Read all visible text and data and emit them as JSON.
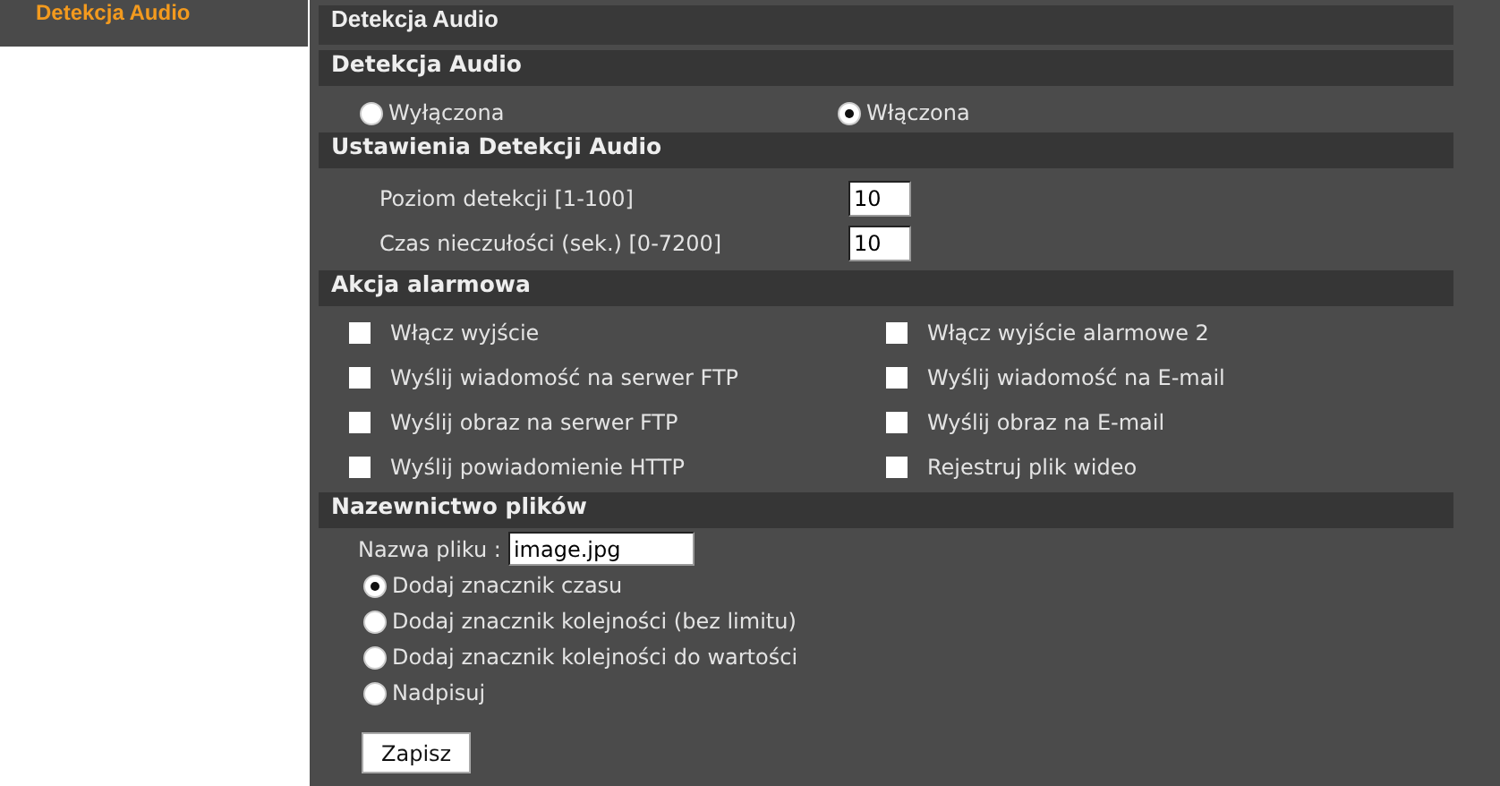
{
  "sidebar": {
    "items": [
      {
        "label": "Detekcja Audio",
        "selected": true
      }
    ]
  },
  "page_title": "Detekcja Audio",
  "sections": [
    {
      "kind": "radios",
      "title": "Detekcja Audio",
      "options": [
        {
          "label": "Wyłączona",
          "selected": false
        },
        {
          "label": "Włączona",
          "selected": true
        }
      ]
    },
    {
      "kind": "fields",
      "title": "Ustawienia Detekcji Audio",
      "fields": [
        {
          "label": "Poziom detekcji [1-100]",
          "value": "10"
        },
        {
          "label": "Czas nieczułości (sek.) [0-7200]",
          "value": "10"
        }
      ]
    },
    {
      "kind": "checkboxes",
      "title": "Akcja alarmowa",
      "items": [
        {
          "label": "Włącz wyjście",
          "checked": false
        },
        {
          "label": "Włącz wyjście alarmowe 2",
          "checked": false
        },
        {
          "label": "Wyślij wiadomość na serwer FTP",
          "checked": false
        },
        {
          "label": "Wyślij wiadomość na E-mail",
          "checked": false
        },
        {
          "label": "Wyślij obraz na serwer FTP",
          "checked": false
        },
        {
          "label": "Wyślij obraz na E-mail",
          "checked": false
        },
        {
          "label": "Wyślij powiadomienie HTTP",
          "checked": false
        },
        {
          "label": "Rejestruj plik wideo",
          "checked": false
        }
      ]
    },
    {
      "kind": "naming",
      "title": "Nazewnictwo plików",
      "field": {
        "label": "Nazwa pliku :",
        "value": "image.jpg"
      },
      "options": [
        {
          "label": "Dodaj znacznik czasu",
          "selected": true
        },
        {
          "label": "Dodaj znacznik kolejności (bez limitu)",
          "selected": false
        },
        {
          "label": "Dodaj znacznik kolejności do wartości",
          "selected": false
        },
        {
          "label": "Nadpisuj",
          "selected": false
        }
      ]
    }
  ],
  "save_button": "Zapisz"
}
